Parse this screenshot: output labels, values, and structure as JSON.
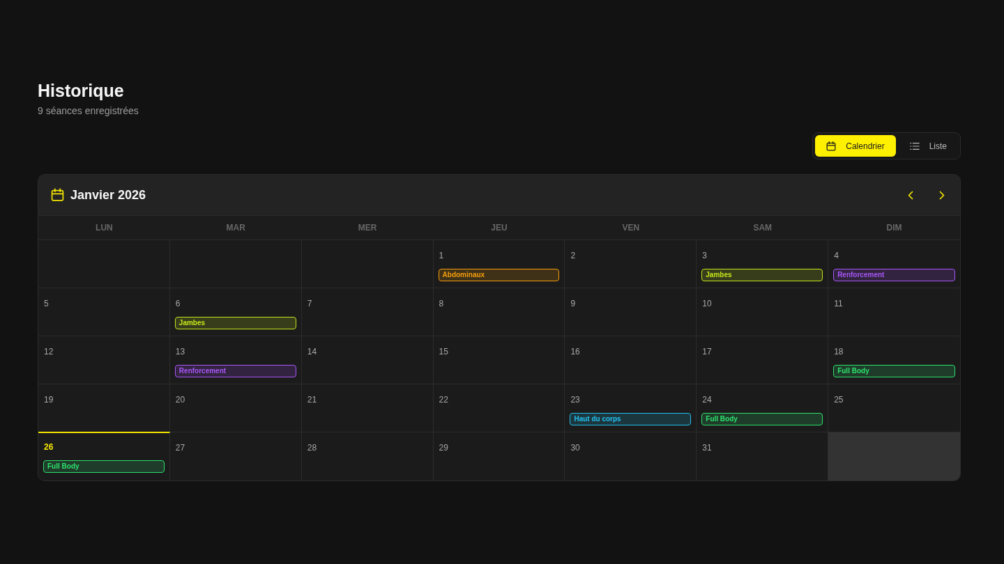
{
  "header": {
    "title": "Historique",
    "subtitle": "9 séances enregistrées"
  },
  "view_toggle": [
    {
      "kind": "calendar",
      "label": "Calendrier",
      "selected": true
    },
    {
      "kind": "list",
      "label": "Liste",
      "selected": false
    }
  ],
  "calendar": {
    "month_title": "Janvier 2026",
    "weekdays": [
      "LUN",
      "MAR",
      "MER",
      "JEU",
      "VEN",
      "SAM",
      "DIM"
    ],
    "weeks": [
      [
        {
          "kind": "empty"
        },
        {
          "kind": "empty"
        },
        {
          "kind": "empty"
        },
        {
          "kind": "day",
          "day": "1",
          "today": false,
          "events": [
            {
              "label": "Abdominaux",
              "color": "#f59e0b"
            }
          ]
        },
        {
          "kind": "day",
          "day": "2",
          "today": false
        },
        {
          "kind": "day",
          "day": "3",
          "today": false,
          "events": [
            {
              "label": "Jambes",
              "color": "#c6e51b"
            }
          ]
        },
        {
          "kind": "day",
          "day": "4",
          "today": false,
          "events": [
            {
              "label": "Renforcement",
              "color": "#a855f7"
            }
          ]
        }
      ],
      [
        {
          "kind": "day",
          "day": "5",
          "today": false
        },
        {
          "kind": "day",
          "day": "6",
          "today": false,
          "events": [
            {
              "label": "Jambes",
              "color": "#c6e51b"
            }
          ]
        },
        {
          "kind": "day",
          "day": "7",
          "today": false
        },
        {
          "kind": "day",
          "day": "8",
          "today": false
        },
        {
          "kind": "day",
          "day": "9",
          "today": false
        },
        {
          "kind": "day",
          "day": "10",
          "today": false
        },
        {
          "kind": "day",
          "day": "11",
          "today": false
        }
      ],
      [
        {
          "kind": "day",
          "day": "12",
          "today": false
        },
        {
          "kind": "day",
          "day": "13",
          "today": false,
          "events": [
            {
              "label": "Renforcement",
              "color": "#a855f7"
            }
          ]
        },
        {
          "kind": "day",
          "day": "14",
          "today": false
        },
        {
          "kind": "day",
          "day": "15",
          "today": false
        },
        {
          "kind": "day",
          "day": "16",
          "today": false
        },
        {
          "kind": "day",
          "day": "17",
          "today": false
        },
        {
          "kind": "day",
          "day": "18",
          "today": false,
          "events": [
            {
              "label": "Full Body",
              "color": "#2ee06e"
            }
          ]
        }
      ],
      [
        {
          "kind": "day",
          "day": "19",
          "today": false
        },
        {
          "kind": "day",
          "day": "20",
          "today": false
        },
        {
          "kind": "day",
          "day": "21",
          "today": false
        },
        {
          "kind": "day",
          "day": "22",
          "today": false
        },
        {
          "kind": "day",
          "day": "23",
          "today": false,
          "events": [
            {
              "label": "Haut du corps",
              "color": "#22c0ee"
            }
          ]
        },
        {
          "kind": "day",
          "day": "24",
          "today": false,
          "events": [
            {
              "label": "Full Body",
              "color": "#2ee06e"
            }
          ]
        },
        {
          "kind": "day",
          "day": "25",
          "today": false
        }
      ],
      [
        {
          "kind": "day",
          "day": "26",
          "today": true,
          "events": [
            {
              "label": "Full Body",
              "color": "#2ee06e"
            }
          ]
        },
        {
          "kind": "day",
          "day": "27",
          "today": false
        },
        {
          "kind": "day",
          "day": "28",
          "today": false
        },
        {
          "kind": "day",
          "day": "29",
          "today": false
        },
        {
          "kind": "day",
          "day": "30",
          "today": false
        },
        {
          "kind": "day",
          "day": "31",
          "today": false
        },
        {
          "kind": "padding"
        }
      ]
    ]
  }
}
